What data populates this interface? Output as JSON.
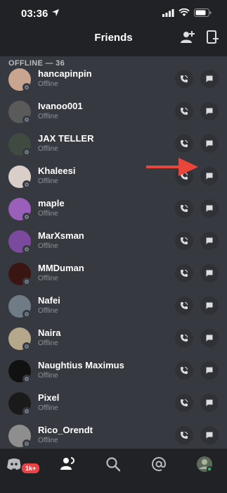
{
  "status_bar": {
    "time": "03:36"
  },
  "header": {
    "title": "Friends"
  },
  "section": {
    "label": "OFFLINE — 36"
  },
  "friends": [
    {
      "name": "hancapinpin",
      "status": "Offline",
      "avatar_color": "#c9a58f"
    },
    {
      "name": "Ivanoo001",
      "status": "Offline",
      "avatar_color": "#5a5a5a"
    },
    {
      "name": "JAX TELLER",
      "status": "Offline",
      "avatar_color": "#3f4a40"
    },
    {
      "name": "Khaleesi",
      "status": "Offline",
      "avatar_color": "#d9cfc8"
    },
    {
      "name": "maple",
      "status": "Offline",
      "avatar_color": "#9a5fb8"
    },
    {
      "name": "MarXsman",
      "status": "Offline",
      "avatar_color": "#7b4a9e"
    },
    {
      "name": "MMDuman",
      "status": "Offline",
      "avatar_color": "#3a1612"
    },
    {
      "name": "Nafei",
      "status": "Offline",
      "avatar_color": "#6f7b85"
    },
    {
      "name": "Naira",
      "status": "Offline",
      "avatar_color": "#b5a88a"
    },
    {
      "name": "Naughtius Maximus",
      "status": "Offline",
      "avatar_color": "#111111"
    },
    {
      "name": "Pixel",
      "status": "Offline",
      "avatar_color": "#1a1a1a"
    },
    {
      "name": "Rico_Orendt",
      "status": "Offline",
      "avatar_color": "#8e8e8e"
    }
  ],
  "tabbar": {
    "badge": "1k+",
    "tabs": [
      "discord-icon",
      "friends-icon",
      "search-icon",
      "mentions-icon",
      "profile-avatar"
    ]
  },
  "colors": {
    "background": "#36393f",
    "bar": "#202225",
    "button": "#2f3136",
    "arrow": "#e8463a",
    "badge": "#ed4245"
  }
}
